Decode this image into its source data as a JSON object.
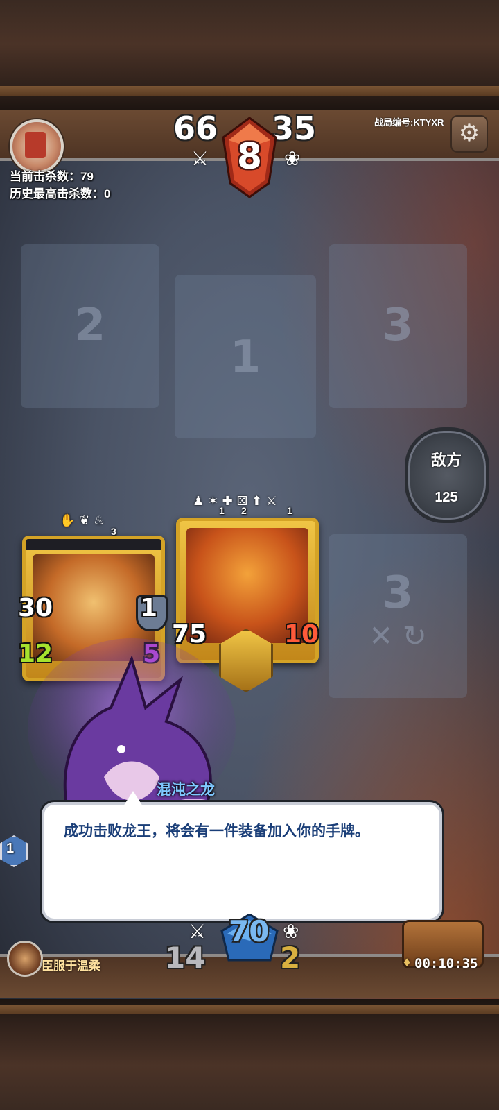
{
  "header": {
    "kill_count_label": "当前击杀数：79",
    "best_kill_label": "历史最高击杀数：0",
    "opponent_attack": "66",
    "opponent_health": "35",
    "turn_gem_value": "8",
    "match_id": "战局编号:KTYXR",
    "attack_icon": "sword-icon",
    "health_icon": "paw-icon",
    "settings_icon": "gear-icon"
  },
  "board": {
    "slots": [
      {
        "label": "2"
      },
      {
        "label": "1"
      },
      {
        "label": "3"
      },
      {
        "label": "3"
      }
    ],
    "enemy_button": {
      "label": "敌方",
      "count": "125"
    }
  },
  "cards": [
    {
      "name": "griffin-rider-card",
      "top_badge": "3",
      "attack": "30",
      "armor": "1",
      "speed": "12",
      "extra": "5"
    },
    {
      "name": "samurai-card",
      "top_badges": [
        "1",
        "2",
        "1"
      ],
      "attack": "75",
      "damage": "10"
    }
  ],
  "dialogue": {
    "speaker": "混沌之龙",
    "text": "成功击败龙王，将会有一件装备加入你的手牌。"
  },
  "footer": {
    "player_name": "臣服于温柔",
    "player_attack": "14",
    "player_health": "2",
    "player_gem_value": "70",
    "level_badge": "1",
    "timer": "00:10:35"
  },
  "colors": {
    "gem_red": "#d84a2a",
    "gem_blue": "#3a8ad8",
    "card_gold": "#d4a326",
    "speed_green": "#a6e22e",
    "damage_red": "#ff5a3a",
    "speaker_blue": "#7fc8ff",
    "dialog_text": "#1a3e78"
  }
}
